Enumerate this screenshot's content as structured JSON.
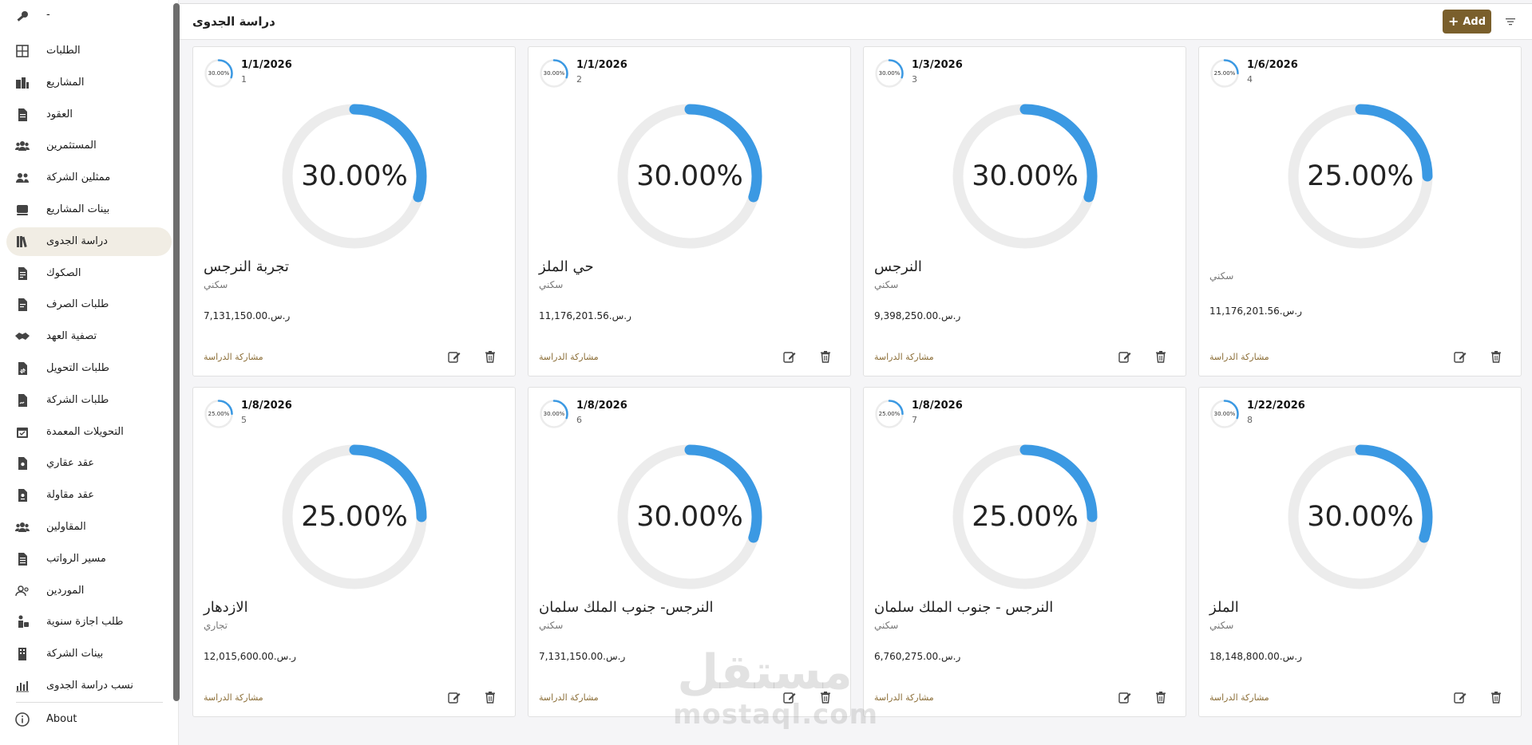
{
  "sidebar": {
    "top_item": {
      "label": "-",
      "icon": "key-icon"
    },
    "items": [
      {
        "label": "الطلبات",
        "icon": "grid-icon"
      },
      {
        "label": "المشاريع",
        "icon": "buildings-icon"
      },
      {
        "label": "العقود",
        "icon": "document-icon"
      },
      {
        "label": "المستثمرين",
        "icon": "users-icon"
      },
      {
        "label": "ممثلين الشركة",
        "icon": "user-pair-icon"
      },
      {
        "label": "بينات المشاريع",
        "icon": "stack-icon"
      },
      {
        "label": "دراسة الجدوى",
        "icon": "books-icon",
        "active": true
      },
      {
        "label": "الصكوك",
        "icon": "deed-icon"
      },
      {
        "label": "طلبات الصرف",
        "icon": "file-lines-icon"
      },
      {
        "label": "تصفية العهد",
        "icon": "handshake-icon"
      },
      {
        "label": "طلبات التحويل",
        "icon": "file-transfer-icon"
      },
      {
        "label": "طلبات الشركة",
        "icon": "file-signature-icon"
      },
      {
        "label": "التحويلات المعمدة",
        "icon": "calendar-check-icon"
      },
      {
        "label": "عقد عقاري",
        "icon": "file-location-icon"
      },
      {
        "label": "عقد مقاولة",
        "icon": "file-contract-icon"
      },
      {
        "label": "المقاولين",
        "icon": "users-icon"
      },
      {
        "label": "مسير الرواتب",
        "icon": "payroll-icon"
      },
      {
        "label": "الموردين",
        "icon": "user-outline-icon"
      },
      {
        "label": "طلب اجازة سنوية",
        "icon": "person-bag-icon"
      },
      {
        "label": "بينات الشركة",
        "icon": "building-icon"
      },
      {
        "label": "نسب دراسة الجدوى",
        "icon": "bar-chart-icon"
      }
    ],
    "about": {
      "label": "About",
      "icon": "info-icon"
    }
  },
  "header": {
    "title": "دراسة الجدوى",
    "add_label": "Add",
    "filter_icon": "filter-icon"
  },
  "cards": [
    {
      "percent": 30,
      "percent_label": "30.00%",
      "date": "1/1/2026",
      "number": "1",
      "name": "تجربة النرجس",
      "type": "سكني",
      "amount": "7,131,150.00.ر.س",
      "share_label": "مشاركة الدراسة"
    },
    {
      "percent": 30,
      "percent_label": "30.00%",
      "date": "1/1/2026",
      "number": "2",
      "name": "حي الملز",
      "type": "سكني",
      "amount": "11,176,201.56.ر.س",
      "share_label": "مشاركة الدراسة"
    },
    {
      "percent": 30,
      "percent_label": "30.00%",
      "date": "1/3/2026",
      "number": "3",
      "name": "النرجس",
      "type": "سكني",
      "amount": "9,398,250.00.ر.س",
      "share_label": "مشاركة الدراسة"
    },
    {
      "percent": 25,
      "percent_label": "25.00%",
      "date": "1/6/2026",
      "number": "4",
      "name": "",
      "type": "سكني",
      "amount": "11,176,201.56.ر.س",
      "share_label": "مشاركة الدراسة"
    },
    {
      "percent": 25,
      "percent_label": "25.00%",
      "date": "1/8/2026",
      "number": "5",
      "name": "الازدهار",
      "type": "تجاري",
      "amount": "12,015,600.00.ر.س",
      "share_label": "مشاركة الدراسة"
    },
    {
      "percent": 30,
      "percent_label": "30.00%",
      "date": "1/8/2026",
      "number": "6",
      "name": "النرجس- جنوب الملك سلمان",
      "type": "سكني",
      "amount": "7,131,150.00.ر.س",
      "share_label": "مشاركة الدراسة"
    },
    {
      "percent": 25,
      "percent_label": "25.00%",
      "date": "1/8/2026",
      "number": "7",
      "name": "النرجس - جنوب الملك سلمان",
      "type": "سكني",
      "amount": "6,760,275.00.ر.س",
      "share_label": "مشاركة الدراسة"
    },
    {
      "percent": 30,
      "percent_label": "30.00%",
      "date": "1/22/2026",
      "number": "8",
      "name": "الملز",
      "type": "سكني",
      "amount": "18,148,800.00.ر.س",
      "share_label": "مشاركة الدراسة"
    }
  ],
  "watermark": {
    "arabic": "مستقل",
    "latin": "mostaql.com"
  },
  "colors": {
    "accent": "#7a5f2c",
    "ring_fill": "#3b99e3",
    "ring_track": "#ececec",
    "active_bg": "#f1ede4"
  }
}
